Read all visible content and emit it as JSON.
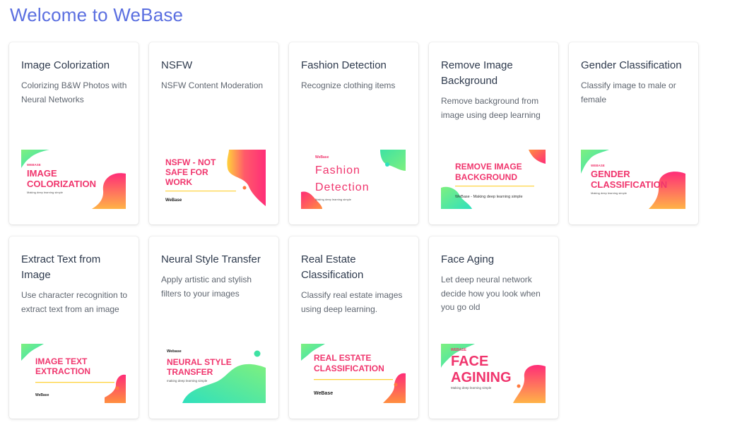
{
  "page": {
    "title": "Welcome to WeBase"
  },
  "cards": [
    {
      "title": "Image Colorization",
      "description": "Colorizing B&W Photos with Neural Networks",
      "thumb": {
        "brand": "WEBASE",
        "line1": "IMAGE",
        "line2": "COLORIZATION",
        "tagline": "Making deep learning simple"
      }
    },
    {
      "title": "NSFW",
      "description": "NSFW Content Moderation",
      "thumb": {
        "line1": "NSFW - NOT",
        "line2": "SAFE FOR",
        "line3": "WORK",
        "brand": "WeBase"
      }
    },
    {
      "title": "Fashion Detection",
      "description": "Recognize clothing items",
      "thumb": {
        "brand": "WeBase",
        "line1": "Fashion",
        "line2": "Detection",
        "tagline": "Making deep learning simple"
      }
    },
    {
      "title": "Remove Image Background",
      "description": "Remove background from image using deep learning",
      "thumb": {
        "line1": "REMOVE IMAGE",
        "line2": "BACKGROUND",
        "tagline": "WeBase - Making deep learning simple"
      }
    },
    {
      "title": "Gender Classification",
      "description": "Classify image to male or female",
      "thumb": {
        "brand": "WEBASE",
        "line1": "GENDER",
        "line2": "CLASSIFICATION",
        "tagline": "Making deep learning simple"
      }
    },
    {
      "title": "Extract Text from Image",
      "description": "Use character recognition to extract text from an image",
      "thumb": {
        "line1": "IMAGE TEXT",
        "line2": "EXTRACTION",
        "brand": "WeBase"
      }
    },
    {
      "title": "Neural Style Transfer",
      "description": "Apply artistic and stylish filters to your images",
      "thumb": {
        "brand": "Webase",
        "line1": "NEURAL STYLE",
        "line2": "TRANSFER",
        "tagline": "making deep learning simple"
      }
    },
    {
      "title": "Real Estate Classification",
      "description": "Classify real estate images using deep learning.",
      "thumb": {
        "line1": "REAL ESTATE",
        "line2": "CLASSIFICATION",
        "brand": "WeBase"
      }
    },
    {
      "title": "Face Aging",
      "description": "Let deep neural network decide how you look when you go old",
      "thumb": {
        "brand": "WEBASE",
        "line1": "FACE",
        "line2": "AGINING",
        "tagline": "Making deep learning simple"
      }
    }
  ],
  "colors": {
    "title": "#5b6fe0",
    "thumb_text": "#f0356d",
    "accent_pink": "#ff2d78",
    "accent_orange": "#ff8f3f",
    "accent_yellow": "#ffd23a",
    "accent_green": "#3ee2a3",
    "accent_lime": "#7ef07f",
    "accent_teal": "#2fe0bd"
  }
}
